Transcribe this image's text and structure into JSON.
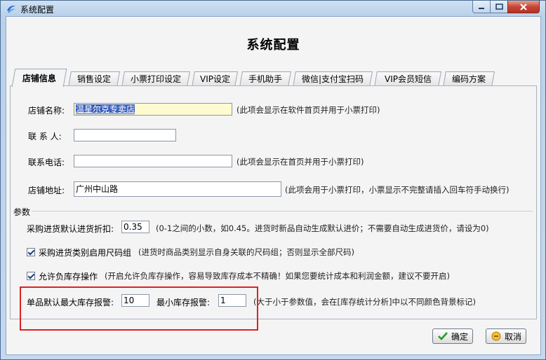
{
  "window": {
    "title": "系统配置"
  },
  "dialog": {
    "title": "系统配置"
  },
  "tabs": [
    {
      "label": "店铺信息",
      "active": true
    },
    {
      "label": "销售设定",
      "active": false
    },
    {
      "label": "小票打印设定",
      "active": false
    },
    {
      "label": "VIP设定",
      "active": false
    },
    {
      "label": "手机助手",
      "active": false
    },
    {
      "label": "微信|支付宝扫码",
      "active": false
    },
    {
      "label": "VIP会员短信",
      "active": false
    },
    {
      "label": "编码方案",
      "active": false
    }
  ],
  "store": {
    "name_label": "店铺名称:",
    "name_value": "温星尔克专卖店",
    "name_hint": "(此项会显示在软件首页并用于小票打印)",
    "contact_label": "联  系  人:",
    "contact_value": "",
    "phone_label": "联系电话:",
    "phone_value": "",
    "phone_hint": "(此项会显示在首页并用于小票打印)",
    "address_label": "店铺地址:",
    "address_value": "广州中山路",
    "address_hint": "(此项会用于小票打印，小票显示不完整请插入回车符手动换行)"
  },
  "params": {
    "group_label": "参数",
    "discount_label": "采购进货默认进货折扣:",
    "discount_value": "0.35",
    "discount_hint": "(0-1之间的小数，如0.45。进货时新品自动生成默认进价；不需要自动生成进货价，请设为0)",
    "size_group_label": "采购进货类别启用尺码组",
    "size_group_checked": true,
    "size_group_hint": "(进货时商品类别显示自身关联的尺码组；否则显示全部尺码)",
    "negative_stock_label": "允许负库存操作",
    "negative_stock_checked": true,
    "negative_stock_hint": "(开启允许负库存操作，容易导致库存成本不精确！如果您要统计成本和利润金额，建议不要开启)",
    "max_stock_label": "单品默认最大库存报警:",
    "max_stock_value": "10",
    "min_stock_label": "最小库存报警:",
    "min_stock_value": "1",
    "stock_hint": "(大于小于参数值，会在[库存统计分析]中以不同颜色背景标记)"
  },
  "buttons": {
    "ok": "确定",
    "cancel": "取消"
  },
  "colors": {
    "accent_highlight": "#e02020",
    "selection": "#3b5fbe"
  },
  "icons": {
    "app": "app-logo-icon",
    "ok": "check-icon",
    "cancel": "cancel-hand-icon"
  }
}
